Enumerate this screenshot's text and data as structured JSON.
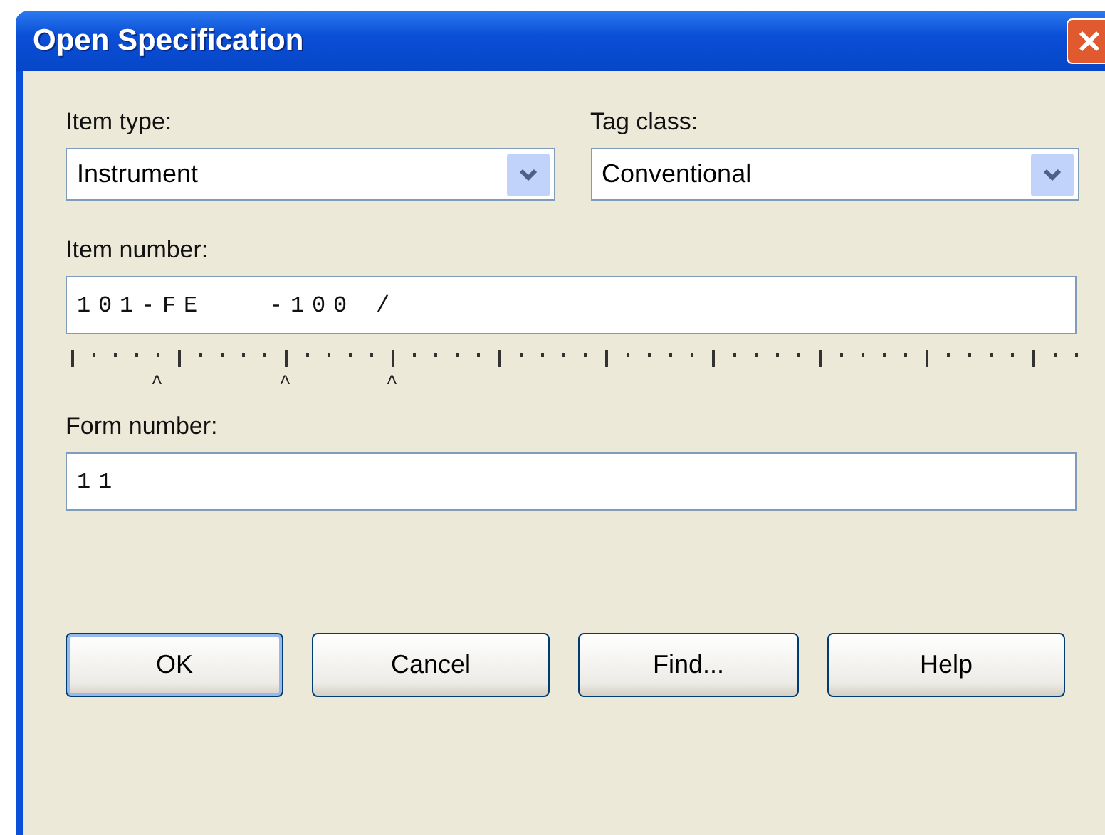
{
  "window": {
    "title": "Open Specification"
  },
  "item_type": {
    "label": "Item type:",
    "value": "Instrument"
  },
  "tag_class": {
    "label": "Tag class:",
    "value": "Conventional"
  },
  "item_number": {
    "label": "Item number:",
    "value": "101-FE   -100 /",
    "markers": "^     ^    ^"
  },
  "form_number": {
    "label": "Form number:",
    "value": "11"
  },
  "buttons": [
    {
      "label": "OK",
      "default": true
    },
    {
      "label": "Cancel",
      "default": false
    },
    {
      "label": "Find...",
      "default": false
    },
    {
      "label": "Help",
      "default": false
    }
  ]
}
